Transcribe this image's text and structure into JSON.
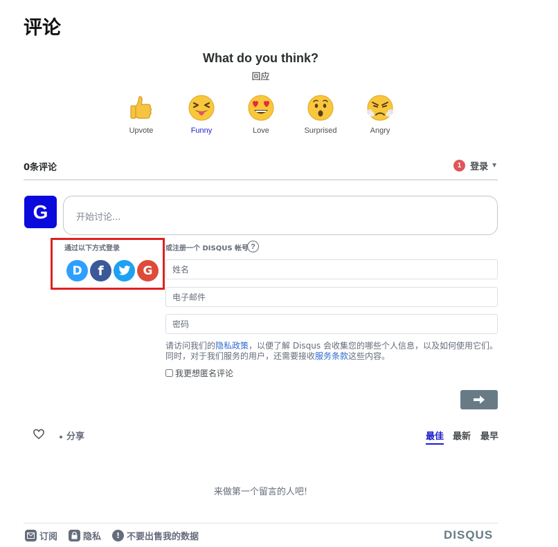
{
  "page": {
    "heading": "评论"
  },
  "reactions": {
    "title": "What do you think?",
    "subtitle": "回应",
    "items": [
      {
        "label": "Upvote",
        "icon": "thumbs-up-emoji"
      },
      {
        "label": "Funny",
        "icon": "squinting-tongue-emoji"
      },
      {
        "label": "Love",
        "icon": "heart-eyes-emoji"
      },
      {
        "label": "Surprised",
        "icon": "surprised-emoji"
      },
      {
        "label": "Angry",
        "icon": "angry-steam-emoji"
      }
    ]
  },
  "thread": {
    "count_label": "0条评论",
    "notification_count": "1",
    "login_label": "登录"
  },
  "composer": {
    "avatar_letter": "G",
    "placeholder": "开始讨论..."
  },
  "login": {
    "social_title": "通过以下方式登录",
    "register_title": "或注册一个 DISQUS 帐号",
    "help_symbol": "?",
    "social": {
      "disqus_letter": "D",
      "facebook_letter": "f",
      "google_letter": "G"
    },
    "name_placeholder": "姓名",
    "email_placeholder": "电子邮件",
    "password_placeholder": "密码",
    "privacy_before": "请访问我们的",
    "privacy_link": "隐私政策",
    "privacy_middle": "，以便了解 Disqus 会收集您的哪些个人信息，以及如何使用它们。同时，对于我们服务的用户，还需要接收",
    "terms_link": "服务条款",
    "privacy_after": "这些内容。",
    "guest_label": "我更想匿名评论"
  },
  "actions": {
    "share_label": "分享",
    "sort_tabs": [
      "最佳",
      "最新",
      "最早"
    ],
    "active_sort": "最佳"
  },
  "empty_state": "来做第一个留言的人吧!",
  "footer": {
    "subscribe_label": "订阅",
    "privacy_label": "隐私",
    "do_not_sell_label": "不要出售我的数据",
    "logo_text": "DISQUS"
  },
  "colors": {
    "accent": "#1c1ccc",
    "avatar_bg": "#0a0add",
    "highlight_box": "#e02020",
    "disqus_blue": "#2e9fff",
    "facebook": "#3b5998",
    "twitter": "#1da1f2",
    "google": "#dd4b39",
    "submit_bg": "#687a86",
    "badge": "#e0555a"
  }
}
